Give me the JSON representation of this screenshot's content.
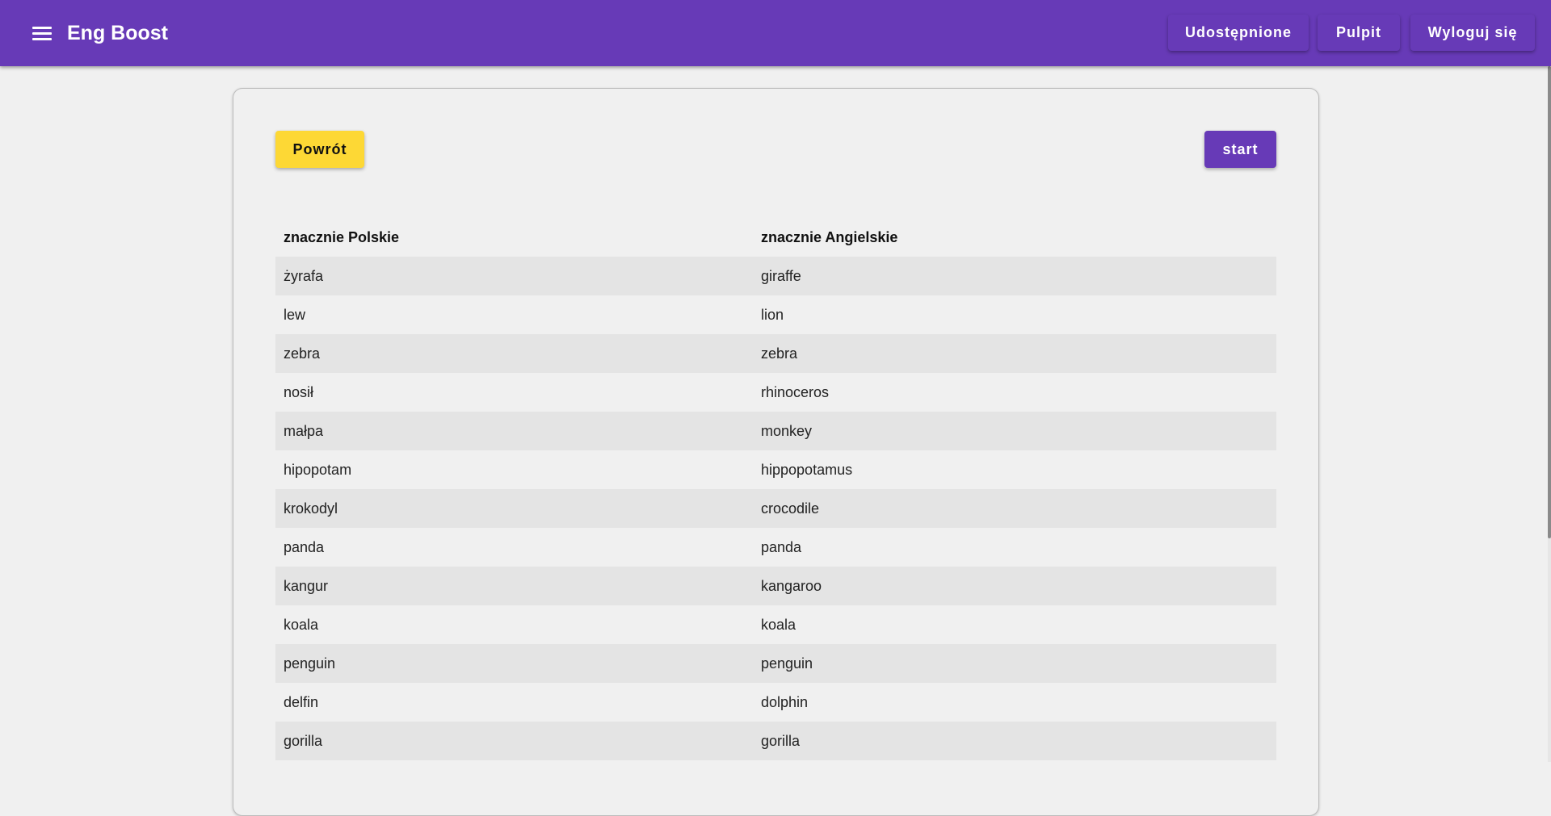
{
  "appbar": {
    "title": "Eng Boost",
    "menu_icon": "hamburger-menu-icon",
    "nav": [
      {
        "label": "Udostępnione"
      },
      {
        "label": "Pulpit"
      },
      {
        "label": "Wyloguj się"
      }
    ],
    "color": "#673ab7"
  },
  "card": {
    "back_label": "Powrót",
    "start_label": "start",
    "back_color": "#fdd835",
    "start_color": "#673ab7"
  },
  "table": {
    "headers": [
      "znacznie Polskie",
      "znacznie Angielskie"
    ],
    "rows": [
      [
        "żyrafa",
        "giraffe"
      ],
      [
        "lew",
        "lion"
      ],
      [
        "zebra",
        "zebra"
      ],
      [
        "nosił",
        "rhinoceros"
      ],
      [
        "małpa",
        "monkey"
      ],
      [
        "hipopotam",
        "hippopotamus"
      ],
      [
        "krokodyl",
        "crocodile"
      ],
      [
        "panda",
        "panda"
      ],
      [
        "kangur",
        "kangaroo"
      ],
      [
        "koala",
        "koala"
      ],
      [
        "penguin",
        "penguin"
      ],
      [
        "delfin",
        "dolphin"
      ],
      [
        "gorilla",
        "gorilla"
      ]
    ]
  }
}
